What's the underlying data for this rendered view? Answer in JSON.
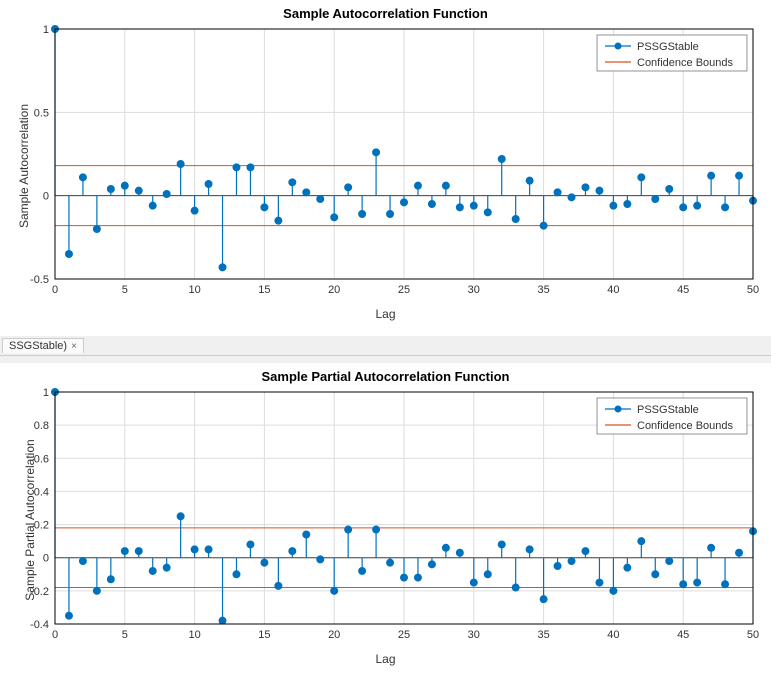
{
  "tab": {
    "label": "SSGStable)",
    "close": "×"
  },
  "legend": {
    "series": "PSSGStable",
    "bounds": "Confidence Bounds"
  },
  "chart_data": [
    {
      "type": "stem",
      "title": "Sample Autocorrelation Function",
      "xlabel": "Lag",
      "ylabel": "Sample Autocorrelation",
      "xlim": [
        0,
        50
      ],
      "ylim": [
        -0.5,
        1.0
      ],
      "yticks": [
        -0.5,
        0,
        0.5,
        1.0
      ],
      "xticks": [
        0,
        5,
        10,
        15,
        20,
        25,
        30,
        35,
        40,
        45,
        50
      ],
      "confidence": 0.18,
      "x": [
        0,
        1,
        2,
        3,
        4,
        5,
        6,
        7,
        8,
        9,
        10,
        11,
        12,
        13,
        14,
        15,
        16,
        17,
        18,
        19,
        20,
        21,
        22,
        23,
        24,
        25,
        26,
        27,
        28,
        29,
        30,
        31,
        32,
        33,
        34,
        35,
        36,
        37,
        38,
        39,
        40,
        41,
        42,
        43,
        44,
        45,
        46,
        47,
        48,
        49,
        50
      ],
      "values": [
        1.0,
        -0.35,
        0.11,
        -0.2,
        0.04,
        0.06,
        0.03,
        -0.06,
        0.01,
        0.19,
        -0.09,
        0.07,
        -0.43,
        0.17,
        0.17,
        -0.07,
        -0.15,
        0.08,
        0.02,
        -0.02,
        -0.13,
        0.05,
        -0.11,
        0.26,
        -0.11,
        -0.04,
        0.06,
        -0.05,
        0.06,
        -0.07,
        -0.06,
        -0.1,
        0.22,
        -0.14,
        0.09,
        -0.18,
        0.02,
        -0.01,
        0.05,
        0.03,
        -0.06,
        -0.05,
        0.11,
        -0.02,
        0.04,
        -0.07,
        -0.06,
        0.12,
        -0.07,
        0.12,
        -0.03
      ]
    },
    {
      "type": "stem",
      "title": "Sample Partial Autocorrelation Function",
      "xlabel": "Lag",
      "ylabel": "Sample Partial Autocorrelation",
      "xlim": [
        0,
        50
      ],
      "ylim": [
        -0.4,
        1.0
      ],
      "yticks": [
        -0.4,
        -0.2,
        0,
        0.2,
        0.4,
        0.6,
        0.8,
        1.0
      ],
      "xticks": [
        0,
        5,
        10,
        15,
        20,
        25,
        30,
        35,
        40,
        45,
        50
      ],
      "confidence": 0.18,
      "x": [
        0,
        1,
        2,
        3,
        4,
        5,
        6,
        7,
        8,
        9,
        10,
        11,
        12,
        13,
        14,
        15,
        16,
        17,
        18,
        19,
        20,
        21,
        22,
        23,
        24,
        25,
        26,
        27,
        28,
        29,
        30,
        31,
        32,
        33,
        34,
        35,
        36,
        37,
        38,
        39,
        40,
        41,
        42,
        43,
        44,
        45,
        46,
        47,
        48,
        49,
        50
      ],
      "values": [
        1.0,
        -0.35,
        -0.02,
        -0.2,
        -0.13,
        0.04,
        0.04,
        -0.08,
        -0.06,
        0.25,
        0.05,
        0.05,
        -0.38,
        -0.1,
        0.08,
        -0.03,
        -0.17,
        0.04,
        0.14,
        -0.01,
        -0.2,
        0.17,
        -0.08,
        0.17,
        -0.03,
        -0.12,
        -0.12,
        -0.04,
        0.06,
        0.03,
        -0.15,
        -0.1,
        0.08,
        -0.18,
        0.05,
        -0.25,
        -0.05,
        -0.02,
        0.04,
        -0.15,
        -0.2,
        -0.06,
        0.1,
        -0.1,
        -0.02,
        -0.16,
        -0.15,
        0.06,
        -0.16,
        0.03,
        0.16
      ]
    }
  ]
}
